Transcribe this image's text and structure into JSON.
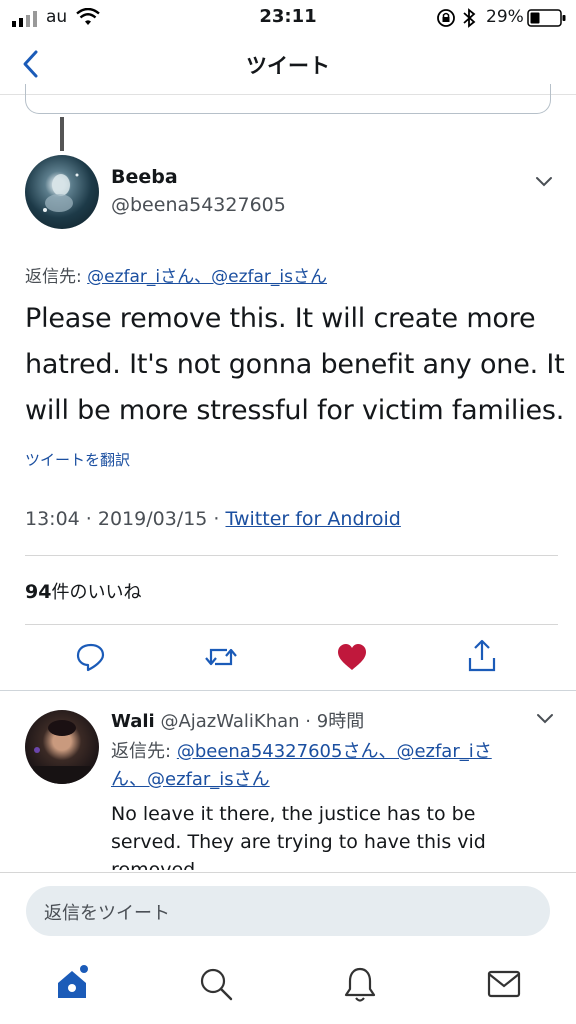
{
  "status_bar": {
    "carrier": "au",
    "time": "23:11",
    "battery": "29%"
  },
  "nav": {
    "title": "ツイート",
    "back_icon": "chevron-left-icon"
  },
  "tweet": {
    "name": "Beeba",
    "handle": "@beena54327605",
    "reply_label": "返信先:",
    "reply_targets": "@ezfar_iさん、@ezfar_isさん",
    "text_lines": [
      "Please remove this. It will create more",
      "hatred. It's not gonna benefit any one. It",
      "will be more stressful for victim families."
    ],
    "translate": "ツイートを翻訳",
    "time_date": "13:04 · 2019/03/15 ·",
    "source": "Twitter for Android",
    "likes_count": "94",
    "likes_label": "件のいいね"
  },
  "reply": {
    "name": "Wali",
    "handle": "@AjazWaliKhan",
    "age": "· 9時間",
    "reply_label": "返信先:",
    "reply_targets_line1": "@beena54327605さん、@ezfar_iさ",
    "reply_targets_line2": "ん、@ezfar_isさん",
    "text_lines": [
      "No leave it there, the justice has to be",
      "served. They are trying to have this vid",
      "removed."
    ]
  },
  "composer": {
    "placeholder": "返信をツイート"
  },
  "colors": {
    "accent": "#1b5bb8",
    "like": "#c0183c",
    "text": "#14171a",
    "muted": "#4a4f55"
  }
}
